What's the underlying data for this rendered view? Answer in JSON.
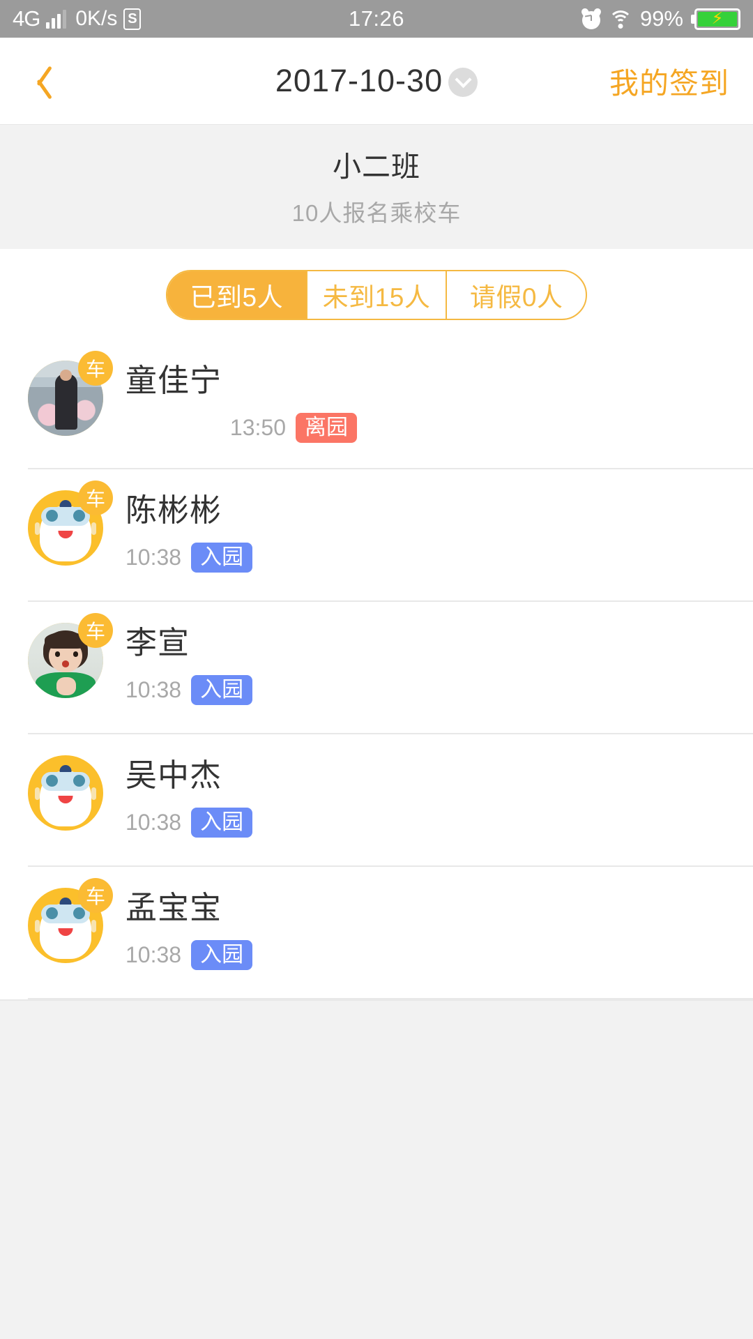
{
  "status_bar": {
    "network": "4G",
    "speed": "0K/s",
    "s_icon_label": "S",
    "time": "17:26",
    "battery_percent": "99%",
    "icons": [
      "signal-bars-icon",
      "s-badge-icon",
      "alarm-clock-icon",
      "wifi-icon",
      "battery-charging-icon"
    ]
  },
  "navbar": {
    "back_icon": "back-chevron-icon",
    "title": "2017-10-30",
    "caret_icon": "chevron-down-icon",
    "action_label": "我的签到"
  },
  "class_header": {
    "name": "小二班",
    "subtitle": "10人报名乘校车"
  },
  "tabs": [
    {
      "label": "已到5人",
      "active": true
    },
    {
      "label": "未到15人",
      "active": false
    },
    {
      "label": "请假0人",
      "active": false
    }
  ],
  "list": [
    {
      "name": "童佳宁",
      "time": "13:50",
      "status": "离园",
      "status_type": "out",
      "avatar_type": "photo-a",
      "bus_badge": "车",
      "meta_align": "right"
    },
    {
      "name": "陈彬彬",
      "time": "10:38",
      "status": "入园",
      "status_type": "in",
      "avatar_type": "robot",
      "bus_badge": "车",
      "meta_align": "left"
    },
    {
      "name": "李宣",
      "time": "10:38",
      "status": "入园",
      "status_type": "in",
      "avatar_type": "photo-b",
      "bus_badge": "车",
      "meta_align": "left"
    },
    {
      "name": "吴中杰",
      "time": "10:38",
      "status": "入园",
      "status_type": "in",
      "avatar_type": "robot",
      "bus_badge": "",
      "meta_align": "left"
    },
    {
      "name": "孟宝宝",
      "time": "10:38",
      "status": "入园",
      "status_type": "in",
      "avatar_type": "robot",
      "bus_badge": "车",
      "meta_align": "left"
    }
  ],
  "colors": {
    "accent": "#f5a623",
    "tab_active": "#f7b33c",
    "badge_in": "#6b8cf7",
    "badge_out": "#fb7565",
    "status_bar": "#9b9b9b",
    "page_bg": "#f2f2f2"
  }
}
